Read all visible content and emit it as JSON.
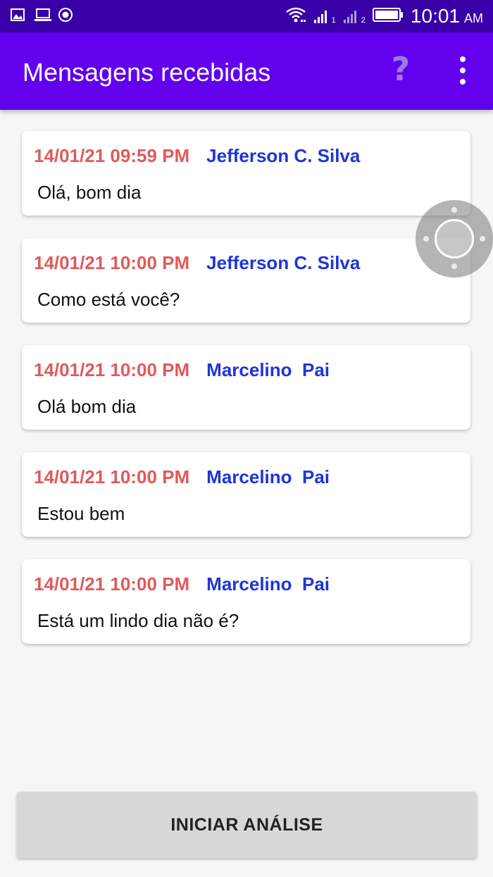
{
  "status_bar": {
    "time": "10:01",
    "ampm": "AM",
    "sim1_label": "1",
    "sim2_label": "2",
    "icons": [
      "gallery-icon",
      "laptop-icon",
      "record-icon",
      "wifi-icon",
      "signal-icon",
      "signal-icon",
      "battery-icon"
    ]
  },
  "app_bar": {
    "title": "Mensagens recebidas",
    "help_label": "?",
    "icons": [
      "help-icon",
      "more-vert-icon"
    ]
  },
  "messages": [
    {
      "date": "14/01/21 09:59 PM",
      "sender": "Jefferson C. Silva",
      "text": "Olá, bom dia"
    },
    {
      "date": "14/01/21 10:00 PM",
      "sender": "Jefferson C. Silva",
      "text": "Como está você?"
    },
    {
      "date": "14/01/21 10:00 PM",
      "sender": "Marcelino  Pai",
      "text": "Olá bom dia"
    },
    {
      "date": "14/01/21 10:00 PM",
      "sender": "Marcelino  Pai",
      "text": "Estou bem"
    },
    {
      "date": "14/01/21 10:00 PM",
      "sender": "Marcelino  Pai",
      "text": "Está um lindo dia não é?"
    }
  ],
  "actions": {
    "start_label": "INICIAR ANÁLISE"
  },
  "colors": {
    "status_bar": "#3a00a8",
    "app_bar": "#6200ee",
    "date": "#e05a5a",
    "sender": "#1f35d6",
    "button": "#d8d8d8"
  }
}
